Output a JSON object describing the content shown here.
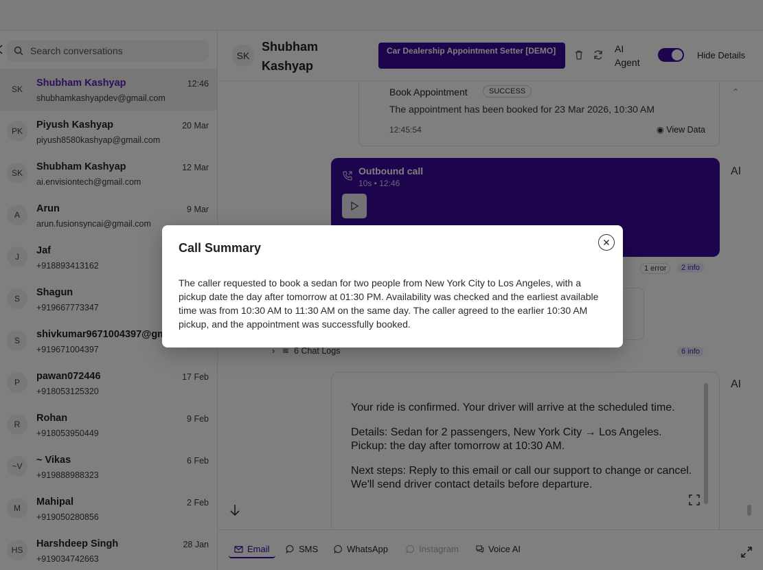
{
  "search": {
    "placeholder": "Search conversations"
  },
  "conversations": [
    {
      "initials": "SK",
      "name": "Shubham Kashyap",
      "sub": "shubhamkashyapdev@gmail.com",
      "date": "12:46",
      "active": true
    },
    {
      "initials": "PK",
      "name": "Piyush Kashyap",
      "sub": "piyush8580kashyap@gmail.com",
      "date": "20 Mar"
    },
    {
      "initials": "SK",
      "name": "Shubham Kashyap",
      "sub": "ai.envisiontech@gmail.com",
      "date": "12 Mar"
    },
    {
      "initials": "A",
      "name": "Arun",
      "sub": "arun.fusionsyncai@gmail.com",
      "date": "9 Mar"
    },
    {
      "initials": "J",
      "name": "Jaf",
      "sub": "+918893413162",
      "date": ""
    },
    {
      "initials": "S",
      "name": "Shagun",
      "sub": "+919667773347",
      "date": ""
    },
    {
      "initials": "S",
      "name": "shivkumar9671004397@gmail.com",
      "sub": "+919671004397",
      "date": ""
    },
    {
      "initials": "P",
      "name": "pawan072446",
      "sub": "+918053125320",
      "date": "17 Feb"
    },
    {
      "initials": "R",
      "name": "Rohan",
      "sub": "+918053950449",
      "date": "9 Feb"
    },
    {
      "initials": "~V",
      "name": "~ Vikas",
      "sub": "+919888988323",
      "date": "6 Feb"
    },
    {
      "initials": "M",
      "name": "Mahipal",
      "sub": "+919050280856",
      "date": "2 Feb"
    },
    {
      "initials": "HS",
      "name": "Harshdeep Singh",
      "sub": "+919034742663",
      "date": "28 Jan"
    }
  ],
  "header": {
    "initials": "SK",
    "name": "Shubham Kashyap",
    "agent_pill": "Car Dealership Appointment Setter [DEMO]",
    "ai_agent_label": "AI Agent",
    "hide_details_label": "Hide Details",
    "toggle_on": true
  },
  "feed": {
    "appointment": {
      "title": "Book Appointment",
      "badge": "SUCCESS",
      "text": "The appointment has been booked for 23 Mar 2026, 10:30 AM",
      "time": "12:45:54",
      "view_data": "View Data"
    },
    "call": {
      "title": "Outbound call",
      "meta": "10s • 12:46"
    },
    "ai_label": "AI",
    "badges": {
      "error": "1 error",
      "info1": "2 info",
      "info2": "6 info"
    },
    "chat_logs": "6 Chat Logs",
    "email_paragraphs": [
      "Your ride is confirmed. Your driver will arrive at the scheduled time.",
      "Details: Sedan for 2 passengers, New York City → Los Angeles. Pickup: the day after tomorrow at 10:30 AM.",
      "Next steps: Reply to this email or call our support to change or cancel. We'll send driver contact details before departure."
    ]
  },
  "channels": [
    {
      "label": "Email",
      "icon": "mail-icon",
      "state": "active"
    },
    {
      "label": "SMS",
      "icon": "chat-bubble-icon",
      "state": "normal"
    },
    {
      "label": "WhatsApp",
      "icon": "whatsapp-icon",
      "state": "normal"
    },
    {
      "label": "Instagram",
      "icon": "instagram-icon",
      "state": "disabled"
    },
    {
      "label": "Voice AI",
      "icon": "voice-ai-icon",
      "state": "normal"
    }
  ],
  "modal": {
    "title": "Call Summary",
    "body": "The caller requested to book a sedan for two people from New York City to Los Angeles, with a pickup date the day after tomorrow at 01:30 PM. Availability was checked and the earliest available time was from 10:30 AM to 11:30 AM on the same day. The caller agreed to the earlier 10:30 AM pickup, and the appointment was successfully booked."
  },
  "colors": {
    "accent": "#3b0b9a",
    "active_name": "#5b21b6"
  }
}
